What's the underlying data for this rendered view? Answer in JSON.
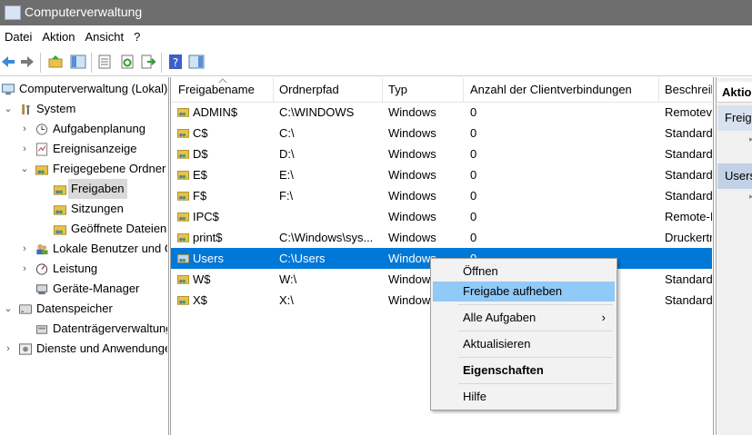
{
  "window": {
    "title": "Computerverwaltung"
  },
  "menu": [
    "Datei",
    "Aktion",
    "Ansicht",
    "?"
  ],
  "tree": [
    {
      "label": "Computerverwaltung (Lokal)",
      "icon": "computer-management-icon",
      "level": 0,
      "expander": ""
    },
    {
      "label": "System",
      "icon": "tools-icon",
      "level": 1,
      "expander": "expanded"
    },
    {
      "label": "Aufgabenplanung",
      "icon": "clock-icon",
      "level": 2,
      "expander": "collapsed"
    },
    {
      "label": "Ereignisanzeige",
      "icon": "event-viewer-icon",
      "level": 2,
      "expander": "collapsed"
    },
    {
      "label": "Freigegebene Ordner",
      "icon": "shared-folder-icon",
      "level": 2,
      "expander": "expanded"
    },
    {
      "label": "Freigaben",
      "icon": "shared-folder-icon",
      "level": 3,
      "expander": "",
      "selected": true
    },
    {
      "label": "Sitzungen",
      "icon": "shared-folder-icon",
      "level": 3,
      "expander": ""
    },
    {
      "label": "Geöffnete Dateien",
      "icon": "shared-folder-icon",
      "level": 3,
      "expander": ""
    },
    {
      "label": "Lokale Benutzer und Gruppen",
      "icon": "users-icon",
      "level": 2,
      "expander": "collapsed"
    },
    {
      "label": "Leistung",
      "icon": "performance-icon",
      "level": 2,
      "expander": "collapsed"
    },
    {
      "label": "Geräte-Manager",
      "icon": "device-manager-icon",
      "level": 2,
      "expander": ""
    },
    {
      "label": "Datenspeicher",
      "icon": "storage-icon",
      "level": 1,
      "expander": "expanded"
    },
    {
      "label": "Datenträgerverwaltung",
      "icon": "disk-management-icon",
      "level": 2,
      "expander": ""
    },
    {
      "label": "Dienste und Anwendungen",
      "icon": "services-icon",
      "level": 1,
      "expander": "collapsed"
    }
  ],
  "columns": [
    "Freigabename",
    "Ordnerpfad",
    "Typ",
    "Anzahl der Clientverbindungen",
    "Beschreibung"
  ],
  "rows": [
    {
      "name": "ADMIN$",
      "path": "C:\\WINDOWS",
      "type": "Windows",
      "clients": "0",
      "desc": "Remoteverwaltung"
    },
    {
      "name": "C$",
      "path": "C:\\",
      "type": "Windows",
      "clients": "0",
      "desc": "Standardfreigabe"
    },
    {
      "name": "D$",
      "path": "D:\\",
      "type": "Windows",
      "clients": "0",
      "desc": "Standardfreigabe"
    },
    {
      "name": "E$",
      "path": "E:\\",
      "type": "Windows",
      "clients": "0",
      "desc": "Standardfreigabe"
    },
    {
      "name": "F$",
      "path": "F:\\",
      "type": "Windows",
      "clients": "0",
      "desc": "Standardfreigabe"
    },
    {
      "name": "IPC$",
      "path": "",
      "type": "Windows",
      "clients": "0",
      "desc": "Remote-IPC"
    },
    {
      "name": "print$",
      "path": "C:\\Windows\\sys...",
      "type": "Windows",
      "clients": "0",
      "desc": "Druckertreiber"
    },
    {
      "name": "Users",
      "path": "C:\\Users",
      "type": "Windows",
      "clients": "0",
      "desc": "",
      "selected": true
    },
    {
      "name": "W$",
      "path": "W:\\",
      "type": "Windows",
      "clients": "0",
      "desc": "Standardfreigabe"
    },
    {
      "name": "X$",
      "path": "X:\\",
      "type": "Windows",
      "clients": "0",
      "desc": "Standardfreigabe"
    }
  ],
  "actions": {
    "header": "Aktionen",
    "section1": "Freigaben",
    "section2": "Users"
  },
  "context_menu": [
    {
      "label": "Öffnen"
    },
    {
      "label": "Freigabe aufheben",
      "highlight": true
    },
    {
      "sep": true
    },
    {
      "label": "Alle Aufgaben",
      "submenu": true
    },
    {
      "sep": true
    },
    {
      "label": "Aktualisieren"
    },
    {
      "sep": true
    },
    {
      "label": "Eigenschaften",
      "bold": true
    },
    {
      "sep": true
    },
    {
      "label": "Hilfe"
    }
  ],
  "colors": {
    "selection": "#0078d7",
    "menu_highlight": "#91c9f7"
  }
}
